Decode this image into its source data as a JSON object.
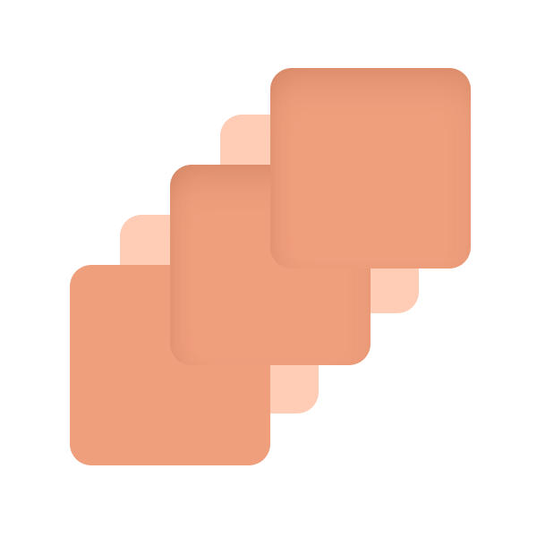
{
  "graphic": {
    "name": "stacked-squares-icon",
    "colors": {
      "background": "#FFFFFF",
      "tile": "#EF9F7C",
      "tile_shadow": "#D98A69",
      "ghost_tile": "#FFCDB6"
    },
    "tiles": [
      {
        "id": "ghost-1",
        "kind": "ghost"
      },
      {
        "id": "tile-1",
        "kind": "main"
      },
      {
        "id": "ghost-2",
        "kind": "ghost"
      },
      {
        "id": "tile-2",
        "kind": "shaded"
      },
      {
        "id": "tile-3",
        "kind": "shaded"
      }
    ]
  }
}
